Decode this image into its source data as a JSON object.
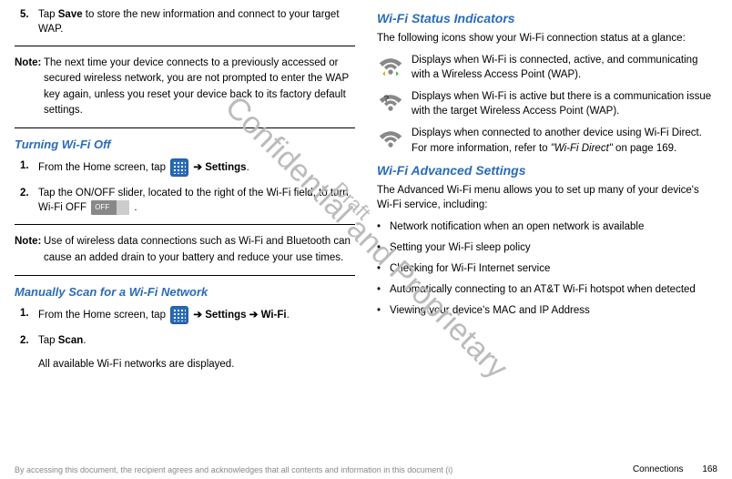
{
  "left": {
    "step5_num": "5.",
    "step5_a": "Tap ",
    "step5_save": "Save",
    "step5_b": " to store the new information and connect to your target WAP.",
    "note1_label": "Note:",
    "note1_body": "The next time your device connects to a previously accessed or secured wireless network, you are not prompted to enter the WAP key again, unless you reset your device back to its factory default settings.",
    "turn_off_head": "Turning Wi-Fi Off",
    "to_step1_num": "1.",
    "to_step1_a": "From the Home screen, tap ",
    "to_step1_arrow": " ➔ ",
    "to_step1_settings": "Settings",
    "to_step1_end": ".",
    "to_step2_num": "2.",
    "to_step2_a": "Tap the ON/OFF slider, located to the right of the Wi-Fi field, to turn Wi-Fi OFF ",
    "off_label": "OFF",
    "to_step2_end": " .",
    "note2_label": "Note:",
    "note2_body": "Use of wireless data connections such as Wi-Fi and Bluetooth can cause an added drain to your battery and reduce your use times.",
    "scan_head": "Manually Scan for a Wi-Fi Network",
    "sc_step1_num": "1.",
    "sc_step1_a": "From the Home screen, tap ",
    "sc_step1_arrow1": " ➔ ",
    "sc_step1_settings": "Settings",
    "sc_step1_arrow2": " ➔ ",
    "sc_step1_wifi": "Wi-Fi",
    "sc_step1_end": ".",
    "sc_step2_num": "2.",
    "sc_step2_a": "Tap ",
    "sc_step2_scan": "Scan",
    "sc_step2_end": ".",
    "sc_result": "All available Wi-Fi networks are displayed."
  },
  "right": {
    "status_head": "Wi-Fi Status Indicators",
    "status_intro": "The following icons show your Wi-Fi connection status at a glance:",
    "icon1_desc": " Displays when Wi-Fi is connected, active, and communicating with a Wireless Access Point (WAP).",
    "icon2_desc": "Displays when Wi-Fi is active but there is a communication issue with the target Wireless Access Point (WAP).",
    "icon3_a": " Displays when connected to another device using Wi-Fi Direct. For more information, refer to ",
    "icon3_ref": "\"Wi-Fi Direct\"",
    "icon3_b": "  on page 169.",
    "adv_head": "Wi-Fi Advanced Settings",
    "adv_intro": "The Advanced Wi-Fi menu allows you to set up many of your device's Wi-Fi service, including:",
    "bullets": [
      "Network notification when an open network is available",
      "Setting your Wi-Fi sleep policy",
      "Checking for Wi-Fi Internet service",
      "Automatically connecting to an AT&T Wi-Fi hotspot when detected",
      "Viewing your device's MAC and IP Address"
    ]
  },
  "footer": {
    "disclaimer": "By accessing this document, the recipient agrees and acknowledges that all contents and information in this document (i)",
    "section": "Connections",
    "page": "168"
  },
  "watermark": {
    "main": "Confidential and Proprietary",
    "draft": "Draft"
  }
}
